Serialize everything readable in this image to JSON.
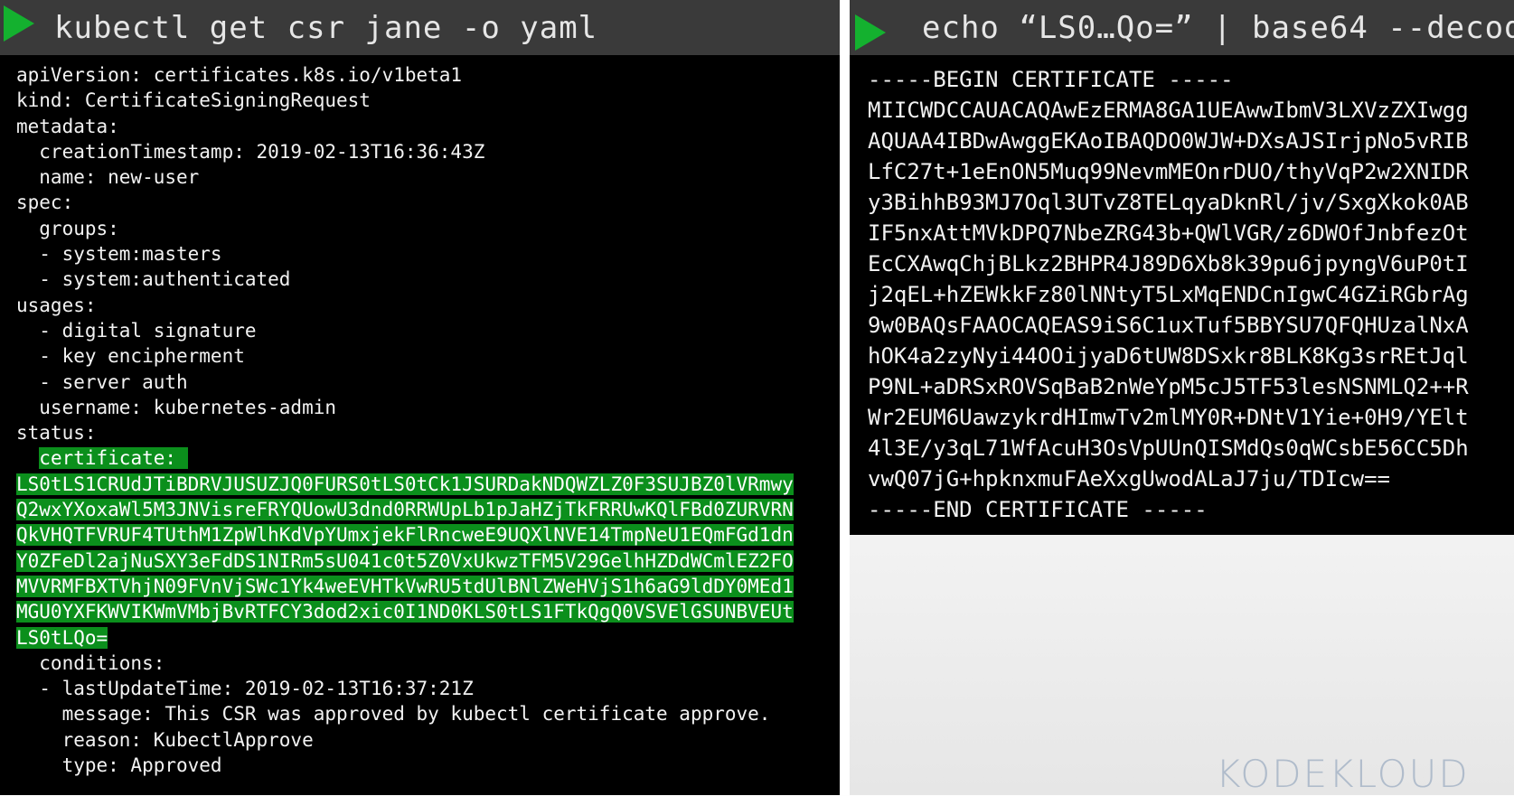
{
  "left_terminal": {
    "command": "kubectl get csr jane -o yaml",
    "lines": [
      "apiVersion: certificates.k8s.io/v1beta1",
      "kind: CertificateSigningRequest",
      "metadata:",
      "  creationTimestamp: 2019-02-13T16:36:43Z",
      "  name: new-user",
      "spec:",
      "  groups:",
      "  - system:masters",
      "  - system:authenticated",
      "usages:",
      "  - digital signature",
      "  - key encipherment",
      "  - server auth",
      "  username: kubernetes-admin",
      "status:"
    ],
    "certificate_key": "certificate: ",
    "certificate_lines": [
      "LS0tLS1CRUdJTiBDRVJUSUZJQ0FURS0tLS0tCk1JSURDakNDQWZLZ0F3SUJBZ0lVRmwy",
      "Q2wxYXoxaWl5M3JNVisreFRYQUowU3dnd0RRWUpLb1pJaHZjTkFRRUwKQlFBd0ZURVRN",
      "QkVHQTFVRUF4TUthM1ZpWlhKdVpYUmxjekFlRncweE9UQXlNVE14TmpNeU1EQmFGd1dn",
      "Y0ZFeDl2ajNuSXY3eFdDS1NIRm5sU041c0t5Z0VxUkwzTFM5V29GelhHZDdWCmlEZ2FO",
      "MVVRMFBXTVhjN09FVnVjSWc1Yk4weEVHTkVwRU5tdUlBNlZWeHVjS1h6aG9ldDY0MEd1",
      "MGU0YXFKWVIKWmVMbjBvRTFCY3dod2xic0I1ND0KLS0tLS1FTkQgQ0VSVElGSUNBVEUt",
      "LS0tLQo="
    ],
    "after_lines": [
      "  conditions:",
      "  - lastUpdateTime: 2019-02-13T16:37:21Z",
      "    message: This CSR was approved by kubectl certificate approve.",
      "    reason: KubectlApprove",
      "    type: Approved"
    ]
  },
  "right_terminal": {
    "command": "echo “LS0…Qo=” | base64 --decode",
    "lines": [
      "-----BEGIN CERTIFICATE -----",
      "MIICWDCCAUACAQAwEzERMA8GA1UEAwwIbmV3LXVzZXIwgg",
      "AQUAA4IBDwAwggEKAoIBAQDO0WJW+DXsAJSIrjpNo5vRIB",
      "LfC27t+1eEnON5Muq99NevmMEOnrDUO/thyVqP2w2XNIDR",
      "y3BihhB93MJ7Oql3UTvZ8TELqyaDknRl/jv/SxgXkok0AB",
      "IF5nxAttMVkDPQ7NbeZRG43b+QWlVGR/z6DWOfJnbfezOt",
      "EcCXAwqChjBLkz2BHPR4J89D6Xb8k39pu6jpyngV6uP0tI",
      "j2qEL+hZEWkkFz80lNNtyT5LxMqENDCnIgwC4GZiRGbrAg",
      "9w0BAQsFAAOCAQEAS9iS6C1uxTuf5BBYSU7QFQHUzalNxA",
      "hOK4a2zyNyi44OOijyaD6tUW8DSxkr8BLK8Kg3srREtJql",
      "P9NL+aDRSxROVSqBaB2nWeYpM5cJ5TF53lesNSNMLQ2++R",
      "Wr2EUM6UawzykrdHImwTv2mlMY0R+DNtV1Yie+0H9/YElt",
      "4l3E/y3qL71WfAcuH3OsVpUUnQISMdQs0qWCsbE56CC5Dh",
      "vwQ07jG+hpknxmuFAeXxgUwodALaJ7ju/TDIcw==",
      "-----END CERTIFICATE -----"
    ]
  },
  "logo": {
    "text": "KODEKLOUD",
    "color": "#b0bccb"
  },
  "colors": {
    "highlight": "#0b8f1c",
    "play": "#14b12f",
    "titlebar": "#3a3a3a"
  }
}
